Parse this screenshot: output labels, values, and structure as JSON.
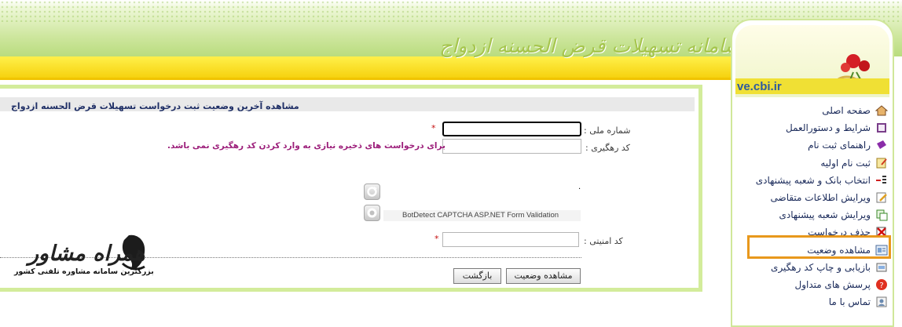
{
  "header": {
    "system_title": "سامانه تسهیلات قرض الحسنه ازدواج"
  },
  "side": {
    "logo_text": "ve.cbi.ir",
    "items": [
      {
        "label": "صفحه اصلی",
        "icon": "home-icon"
      },
      {
        "label": "شرایط و دستورالعمل",
        "icon": "book-icon"
      },
      {
        "label": "راهنمای ثبت نام",
        "icon": "guide-book-icon"
      },
      {
        "label": "ثبت نام اولیه",
        "icon": "edit-form-icon"
      },
      {
        "label": "انتخاب بانک و شعبه پیشنهادی",
        "icon": "select-list-icon"
      },
      {
        "label": "ویرایش اطلاعات متقاضی",
        "icon": "edit-pencil-icon"
      },
      {
        "label": "ویرایش شعبه پیشنهادی",
        "icon": "edit-branch-icon"
      },
      {
        "label": "حذف درخواست",
        "icon": "delete-icon"
      },
      {
        "label": "مشاهده وضعیت",
        "icon": "view-status-icon"
      },
      {
        "label": "بازیابی و چاپ کد رهگیری",
        "icon": "print-icon"
      },
      {
        "label": "پرسش های متداول",
        "icon": "question-icon"
      },
      {
        "label": "تماس با ما",
        "icon": "contact-icon"
      }
    ]
  },
  "main": {
    "title": "مشاهده آخرین وضعیت ثبت درخواست تسهیلات قرض الحسنه ازدواج",
    "national_id_label": "شماره ملی :",
    "national_id_value": "",
    "tracking_label": "کد رهگیری :",
    "tracking_value": "",
    "tracking_warning": "برای درخواست های ذخیره نیازی به وارد کردن کد رهگیری نمی باشد.",
    "captcha_caption": "BotDetect CAPTCHA ASP.NET Form Validation",
    "captcha_label": "کد امنیتی :",
    "captcha_value": "",
    "required_mark": "*",
    "view_status_button": "مشاهده وضعیت",
    "back_button": "بازگشت"
  },
  "watermark": {
    "brand": "همراه مشاور",
    "tagline": "بزرگترین سامانه مشاوره تلفنی کشور"
  },
  "colors": {
    "header_green": "#b9dc7e",
    "header_yellow": "#f6d20f",
    "border_green": "#d3ec9b",
    "highlight_orange": "#e8981c",
    "warning_magenta": "#9c1e7a",
    "required_red": "#c41010"
  }
}
